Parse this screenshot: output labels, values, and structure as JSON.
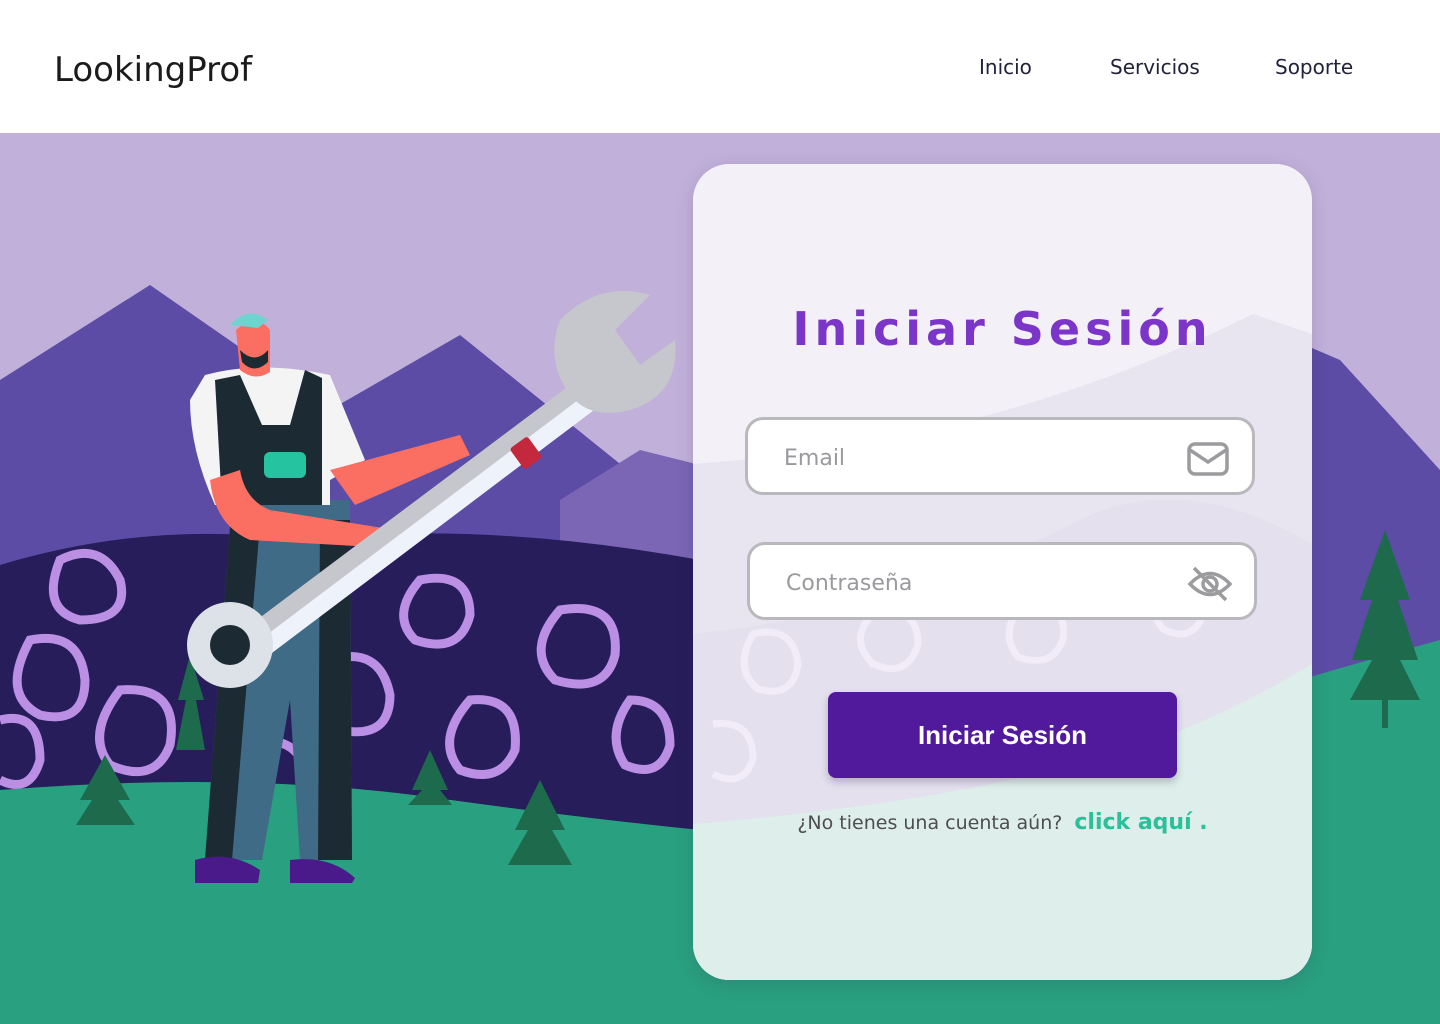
{
  "header": {
    "logo": "LookingProf",
    "nav": [
      {
        "label": "Inicio"
      },
      {
        "label": "Servicios"
      },
      {
        "label": "Soporte"
      }
    ]
  },
  "login": {
    "title": "Iniciar Sesión",
    "email_placeholder": "Email",
    "password_placeholder": "Contraseña",
    "submit_label": "Iniciar Sesión",
    "signup_prompt": "¿No tienes una cuenta aún?",
    "signup_link": "click aquí ."
  },
  "colors": {
    "accent": "#7b35c8",
    "button": "#511a9c",
    "link": "#2bbf9a",
    "sky": "#c1b1da",
    "grass": "#29a07f"
  },
  "icons": {
    "email": "envelope-icon",
    "password": "eye-slash-icon"
  }
}
